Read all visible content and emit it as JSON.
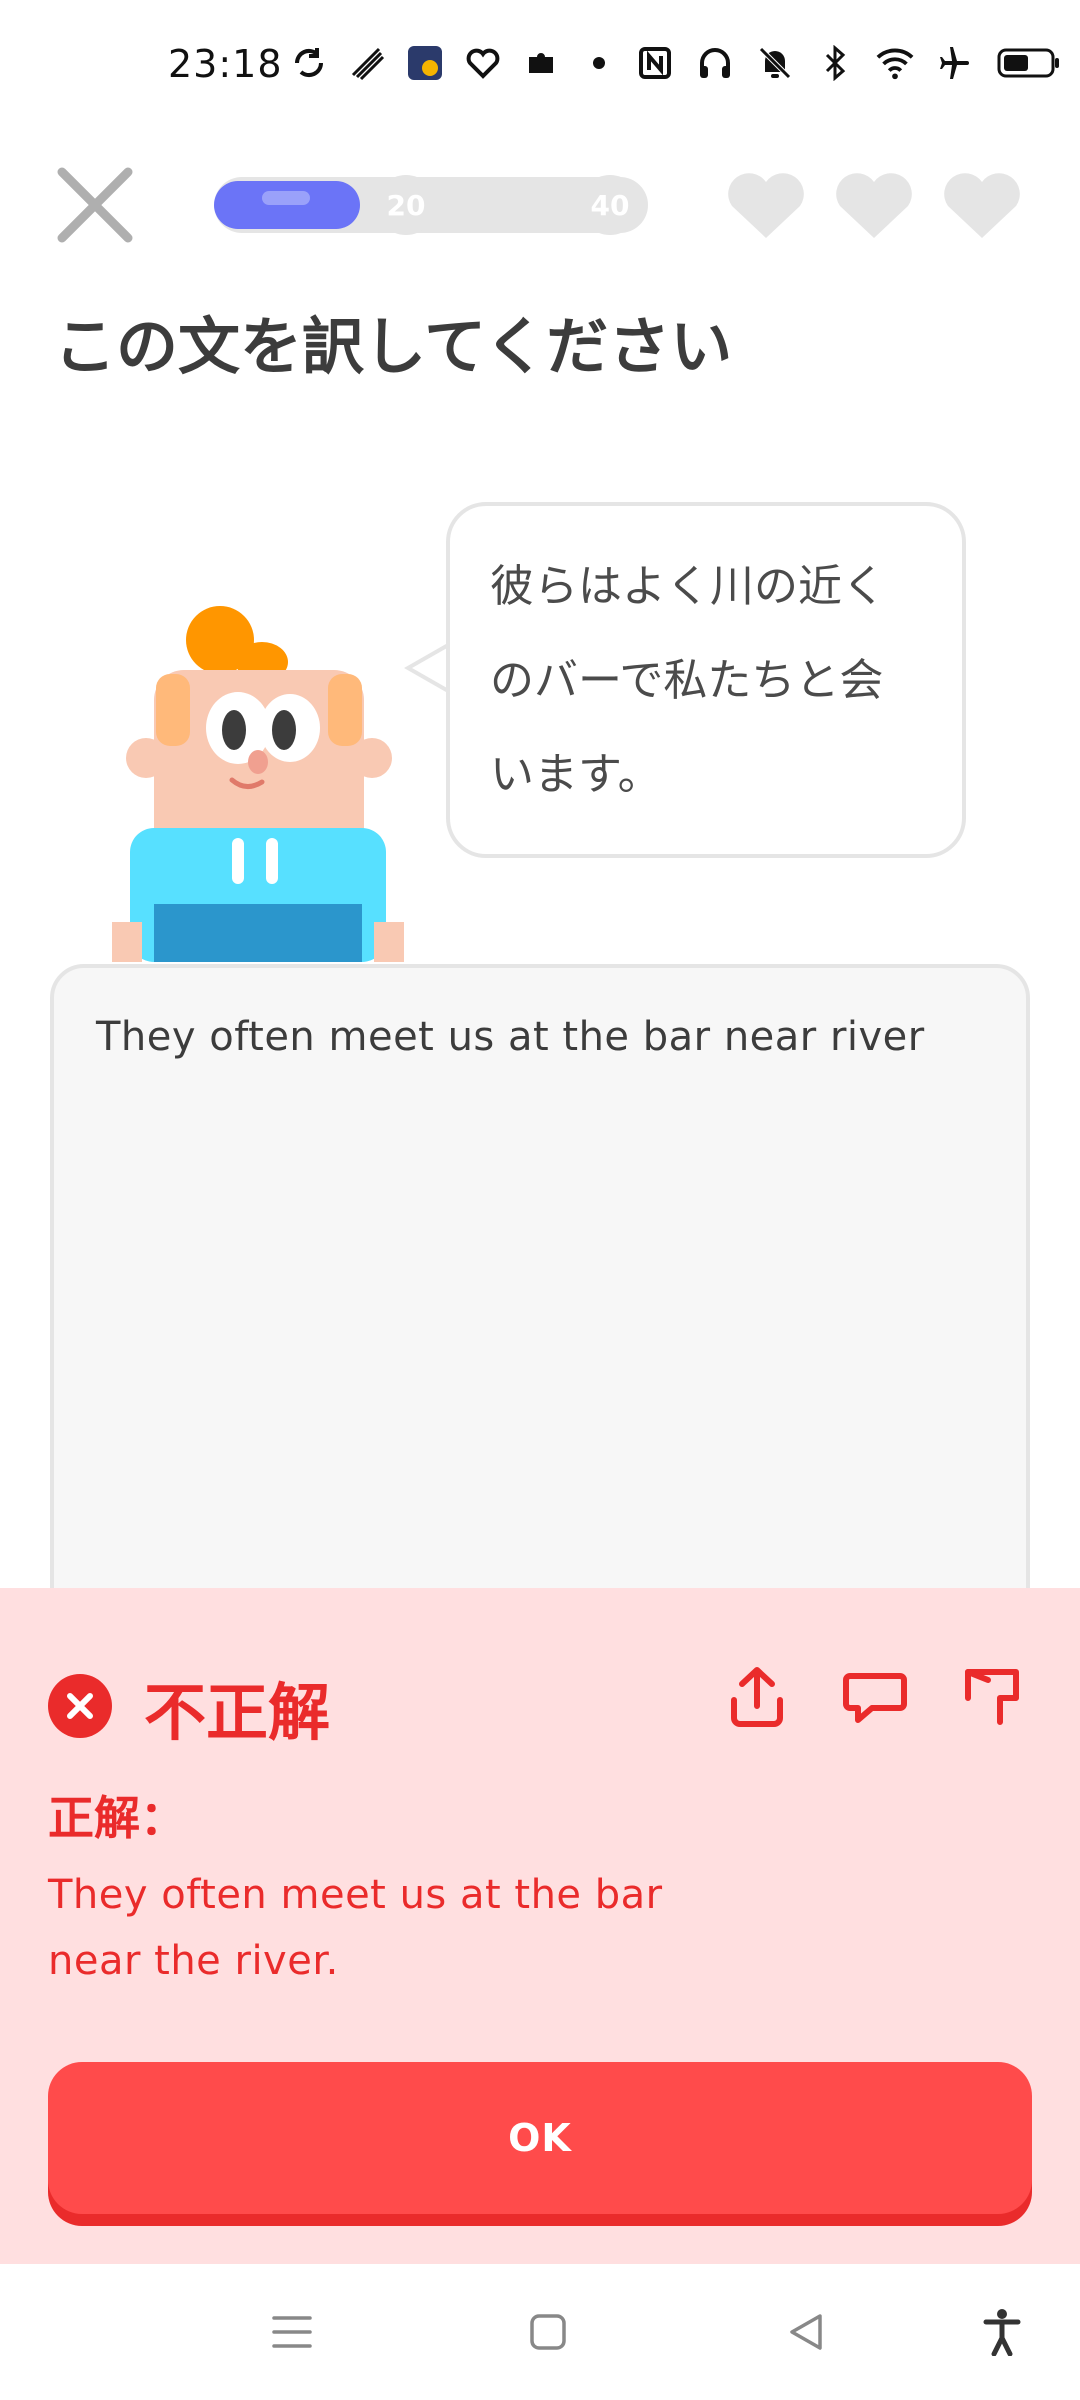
{
  "status_bar": {
    "time": "23:18",
    "left_icons": [
      "sync-icon",
      "antenna-icon",
      "app-badge-icon",
      "heart-outline-icon",
      "puzzle-icon",
      "dot-icon"
    ],
    "right_icons": [
      "nfc-icon",
      "headphones-icon",
      "bell-muted-icon",
      "bluetooth-icon",
      "wifi-icon",
      "airplane-icon",
      "battery-icon"
    ]
  },
  "progress": {
    "fraction": 0.25,
    "milestones": [
      "20",
      "40"
    ],
    "accent_color": "#6b74f7"
  },
  "hearts": {
    "count": 3,
    "color": "#e5e5e5"
  },
  "title": "この文を訳してください",
  "prompt": {
    "lines": [
      "彼らはよく川の近く",
      "のバーで私たちと会",
      "います。"
    ]
  },
  "answer": {
    "value": "They often meet us at the bar near river"
  },
  "feedback": {
    "status": "不正解",
    "correct_label": "正解：",
    "correct_lines": [
      "They often meet us at the bar",
      "near the river."
    ],
    "error_color": "#ea2b2b",
    "actions": [
      "share-icon",
      "comment-icon",
      "flag-icon"
    ]
  },
  "ok_button": {
    "label": "OK"
  },
  "nav_bar": {
    "icons": [
      "menu-icon",
      "home-icon",
      "back-icon",
      "accessibility-icon"
    ]
  }
}
